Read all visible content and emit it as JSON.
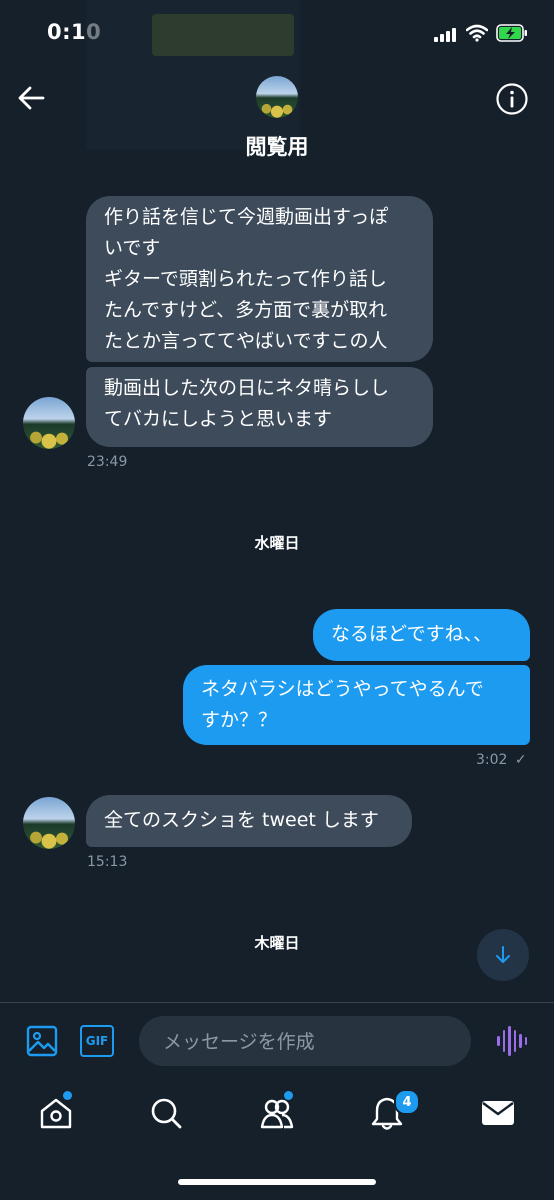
{
  "status_bar": {
    "time": "0:10"
  },
  "header": {
    "title": "閲覧用"
  },
  "messages": [
    {
      "text": "作り話を信じて今週動画出すっぽ\nいです\nギターで頭割られたって作り話し\nたんですけど、多方面で裏が取れ\nたとか言っててやばいですこの人"
    },
    {
      "text": "動画出した次の日にネタ晴らしし\nてバカにしようと思います"
    },
    {
      "time": "23:49"
    },
    {
      "day": "水曜日"
    },
    {
      "text": "なるほどですね、、"
    },
    {
      "text": "ネタバラシはどうやってやるんで\nすか？？"
    },
    {
      "time": "3:02",
      "read_mark": "✓"
    },
    {
      "text": "全てのスクショを tweet します"
    },
    {
      "time": "15:13"
    },
    {
      "day": "木曜日"
    }
  ],
  "composer": {
    "placeholder": "メッセージを作成",
    "gif_label": "GIF"
  },
  "bottom_nav": {
    "notifications_badge": "4",
    "items": [
      "home-icon",
      "search-icon",
      "communities-icon",
      "bell-icon",
      "mail-icon"
    ]
  },
  "colors": {
    "background": "#15202b",
    "incoming_bubble": "#3d4b5b",
    "outgoing_bubble": "#1d9bf0",
    "accent": "#1d9bf0"
  }
}
